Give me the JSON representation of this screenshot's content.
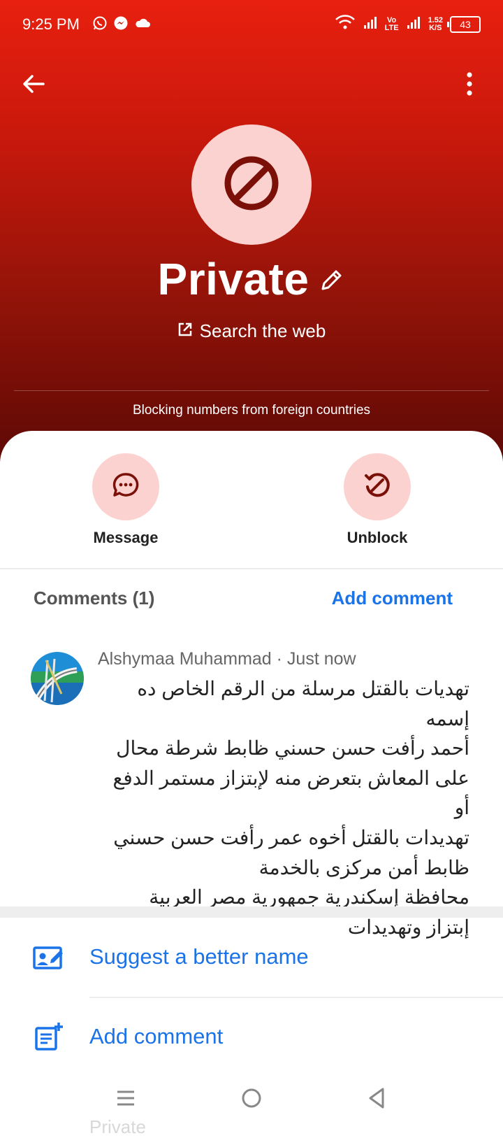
{
  "status_bar": {
    "time": "9:25 PM",
    "volte_top": "Vo",
    "volte_bottom": "LTE",
    "speed_top": "1.52",
    "speed_bottom": "K/S",
    "battery": "43"
  },
  "header": {
    "name": "Private",
    "search_link": "Search the web",
    "block_note": "Blocking numbers from foreign countries"
  },
  "actions": [
    {
      "label": "Message",
      "icon": "message-dots-icon"
    },
    {
      "label": "Unblock",
      "icon": "unblock-icon"
    }
  ],
  "comments": {
    "title": "Comments (1)",
    "add_link": "Add comment",
    "items": [
      {
        "author_meta": "Alshymaa Muhammad · Just now",
        "text": "تهديات بالقتل مرسلة من الرقم الخاص ده إسمه\nأحمد رأفت حسن حسني ظابط شرطة محال\nعلى المعاش بتعرض منه لإبتزاز مستمر الدفع أو\nتهديدات بالقتل أخوه عمر رأفت حسن حسني\nظابط أمن مركزى بالخدمة\nمحافظة إسكندرية جمهورية مصر العربية\nإبتزاز وتهديدات"
      }
    ]
  },
  "options": [
    {
      "label": "Suggest a better name",
      "icon": "suggest-name-icon"
    },
    {
      "label": "Add comment",
      "icon": "add-note-icon"
    }
  ],
  "ghost_text": "Private",
  "colors": {
    "header_top": "#e8200f",
    "header_bottom": "#5e0905",
    "accent_blue": "#1a73e8",
    "icon_pink_bg": "#fbd2d0",
    "icon_dark_red": "#7a1008"
  }
}
